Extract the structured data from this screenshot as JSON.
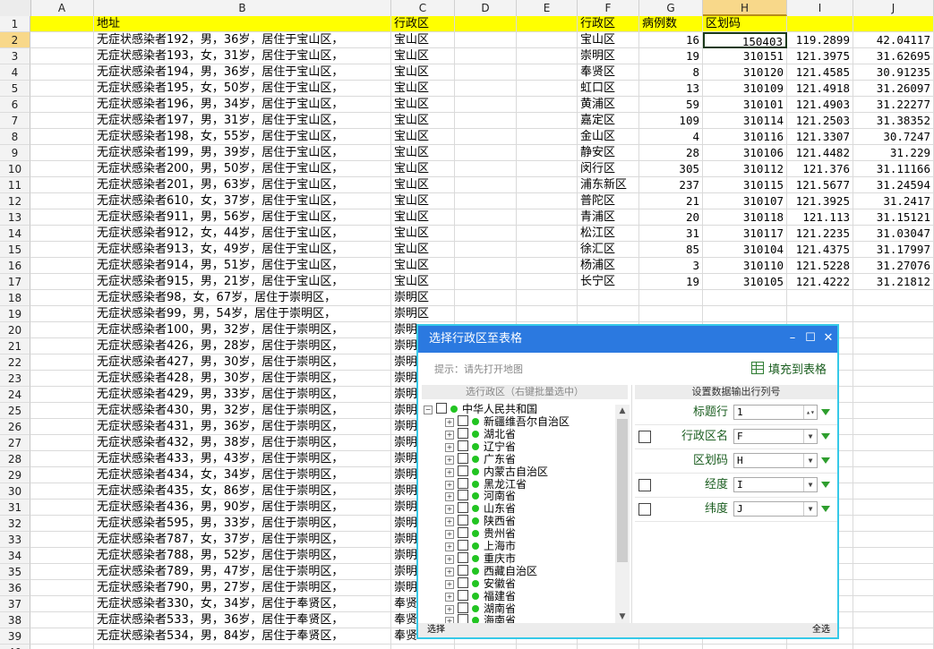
{
  "columns": [
    "A",
    "B",
    "C",
    "D",
    "E",
    "F",
    "G",
    "H",
    "I",
    "J"
  ],
  "header_row": {
    "B": "地址",
    "C": "行政区",
    "F": "行政区",
    "G": "病例数",
    "H": "区划码"
  },
  "col_b": [
    "无症状感染者192，男，36岁，居住于宝山区，",
    "无症状感染者193，女，31岁，居住于宝山区，",
    "无症状感染者194，男，36岁，居住于宝山区，",
    "无症状感染者195，女，50岁，居住于宝山区，",
    "无症状感染者196，男，34岁，居住于宝山区，",
    "无症状感染者197，男，31岁，居住于宝山区，",
    "无症状感染者198，女，55岁，居住于宝山区，",
    "无症状感染者199，男，39岁，居住于宝山区，",
    "无症状感染者200，男，50岁，居住于宝山区，",
    "无症状感染者201，男，63岁，居住于宝山区，",
    "无症状感染者610，女，37岁，居住于宝山区，",
    "无症状感染者911，男，56岁，居住于宝山区，",
    "无症状感染者912，女，44岁，居住于宝山区，",
    "无症状感染者913，女，49岁，居住于宝山区，",
    "无症状感染者914，男，51岁，居住于宝山区，",
    "无症状感染者915，男，21岁，居住于宝山区，",
    "无症状感染者98，女，67岁，居住于崇明区，",
    "无症状感染者99，男，54岁，居住于崇明区，",
    "无症状感染者100，男，32岁，居住于崇明区，",
    "无症状感染者426，男，28岁，居住于崇明区，",
    "无症状感染者427，男，30岁，居住于崇明区，",
    "无症状感染者428，男，30岁，居住于崇明区，",
    "无症状感染者429，男，33岁，居住于崇明区，",
    "无症状感染者430，男，32岁，居住于崇明区，",
    "无症状感染者431，男，36岁，居住于崇明区，",
    "无症状感染者432，男，38岁，居住于崇明区，",
    "无症状感染者433，男，43岁，居住于崇明区，",
    "无症状感染者434，女，34岁，居住于崇明区，",
    "无症状感染者435，女，86岁，居住于崇明区，",
    "无症状感染者436，男，90岁，居住于崇明区，",
    "无症状感染者595，男，33岁，居住于崇明区，",
    "无症状感染者787，女，37岁，居住于崇明区，",
    "无症状感染者788，男，52岁，居住于崇明区，",
    "无症状感染者789，男，47岁，居住于崇明区，",
    "无症状感染者790，男，27岁，居住于崇明区，",
    "无症状感染者330，女，34岁，居住于奉贤区，",
    "无症状感染者533，男，36岁，居住于奉贤区，",
    "无症状感染者534，男，84岁，居住于奉贤区，"
  ],
  "col_c": [
    "宝山区",
    "宝山区",
    "宝山区",
    "宝山区",
    "宝山区",
    "宝山区",
    "宝山区",
    "宝山区",
    "宝山区",
    "宝山区",
    "宝山区",
    "宝山区",
    "宝山区",
    "宝山区",
    "宝山区",
    "宝山区",
    "崇明区",
    "崇明区",
    "崇明",
    "崇明",
    "崇明",
    "崇明",
    "崇明",
    "崇明",
    "崇明",
    "崇明",
    "崇明",
    "崇明",
    "崇明",
    "崇明",
    "崇明",
    "崇明",
    "崇明",
    "崇明",
    "崇明",
    "奉贤",
    "奉贤",
    "奉贤"
  ],
  "table_fj": [
    {
      "F": "宝山区",
      "G": "16",
      "H": "150403",
      "I": "119.2899",
      "J": "42.04117"
    },
    {
      "F": "崇明区",
      "G": "19",
      "H": "310151",
      "I": "121.3975",
      "J": "31.62695"
    },
    {
      "F": "奉贤区",
      "G": "8",
      "H": "310120",
      "I": "121.4585",
      "J": "30.91235"
    },
    {
      "F": "虹口区",
      "G": "13",
      "H": "310109",
      "I": "121.4918",
      "J": "31.26097"
    },
    {
      "F": "黄浦区",
      "G": "59",
      "H": "310101",
      "I": "121.4903",
      "J": "31.22277"
    },
    {
      "F": "嘉定区",
      "G": "109",
      "H": "310114",
      "I": "121.2503",
      "J": "31.38352"
    },
    {
      "F": "金山区",
      "G": "4",
      "H": "310116",
      "I": "121.3307",
      "J": "30.7247"
    },
    {
      "F": "静安区",
      "G": "28",
      "H": "310106",
      "I": "121.4482",
      "J": "31.229"
    },
    {
      "F": "闵行区",
      "G": "305",
      "H": "310112",
      "I": "121.376",
      "J": "31.11166"
    },
    {
      "F": "浦东新区",
      "G": "237",
      "H": "310115",
      "I": "121.5677",
      "J": "31.24594"
    },
    {
      "F": "普陀区",
      "G": "21",
      "H": "310107",
      "I": "121.3925",
      "J": "31.2417"
    },
    {
      "F": "青浦区",
      "G": "20",
      "H": "310118",
      "I": "121.113",
      "J": "31.15121"
    },
    {
      "F": "松江区",
      "G": "31",
      "H": "310117",
      "I": "121.2235",
      "J": "31.03047"
    },
    {
      "F": "徐汇区",
      "G": "85",
      "H": "310104",
      "I": "121.4375",
      "J": "31.17997"
    },
    {
      "F": "杨浦区",
      "G": "3",
      "H": "310110",
      "I": "121.5228",
      "J": "31.27076"
    },
    {
      "F": "长宁区",
      "G": "19",
      "H": "310105",
      "I": "121.4222",
      "J": "31.21812"
    }
  ],
  "dialog": {
    "title": "选择行政区至表格",
    "hint": "提示：请先打开地图",
    "fill_button": "填充到表格",
    "left_header": "选行政区（右键批量选中）",
    "right_header": "设置数据输出行列号",
    "tree_root": "中华人民共和国",
    "tree_items": [
      "新疆维吾尔自治区",
      "湖北省",
      "辽宁省",
      "广东省",
      "内蒙古自治区",
      "黑龙江省",
      "河南省",
      "山东省",
      "陕西省",
      "贵州省",
      "上海市",
      "重庆市",
      "西藏自治区",
      "安徽省",
      "福建省",
      "湖南省",
      "海南省"
    ],
    "fields": [
      {
        "label": "标题行",
        "value": "1",
        "checked": null,
        "kind": "spin"
      },
      {
        "label": "行政区名",
        "value": "F",
        "checked": false,
        "kind": "select"
      },
      {
        "label": "区划码",
        "value": "H",
        "checked": null,
        "kind": "select"
      },
      {
        "label": "经度",
        "value": "I",
        "checked": false,
        "kind": "select"
      },
      {
        "label": "纬度",
        "value": "J",
        "checked": false,
        "kind": "select"
      }
    ],
    "status_left": "选择",
    "status_right": "全选",
    "colors": {
      "titlebar": "#2b79e0",
      "border": "#36c9e8",
      "label": "#1b5e20",
      "dot": "#22c422"
    }
  }
}
